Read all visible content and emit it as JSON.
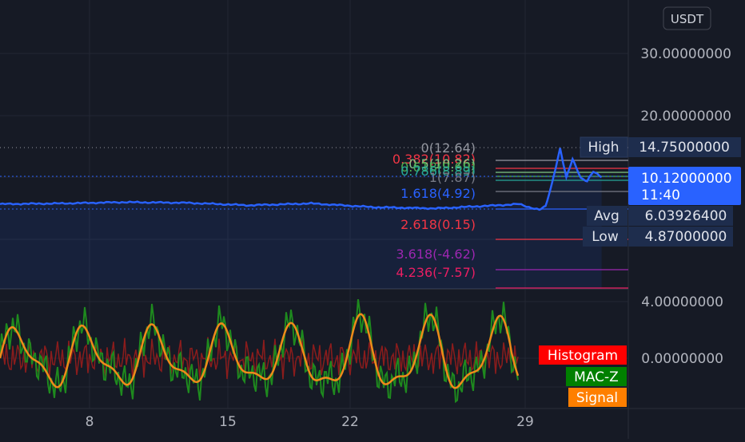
{
  "currency_button": "USDT",
  "chart_data": [
    {
      "type": "line",
      "panel": "price",
      "y_ticks": [
        "30.00000000",
        "20.00000000"
      ],
      "ylim": [
        -12,
        34
      ],
      "x": [
        0,
        3,
        6,
        9,
        12,
        15,
        18,
        21,
        24,
        25,
        25.5,
        26,
        26.3,
        26.6,
        27,
        27.3,
        27.6,
        28,
        28.3,
        28.6,
        29
      ],
      "series": [
        {
          "values": [
            5.8,
            5.9,
            6.1,
            6.0,
            5.6,
            5.9,
            5.3,
            5.1,
            5.6,
            5.8,
            5.3,
            4.9,
            5.4,
            9.0,
            14.75,
            10.0,
            13.0,
            10.0,
            9.5,
            11.0,
            10.12
          ]
        }
      ],
      "last_price": "10.12000000",
      "countdown": "11:40",
      "high_label": "High",
      "high_value": "14.75000000",
      "avg_label": "Avg",
      "avg_value": "6.03926400",
      "low_label": "Low",
      "low_value": "4.87000000",
      "fib_levels": [
        {
          "label": "0(12.64)",
          "color": "#9598a1"
        },
        {
          "label": "0.382(10.82)",
          "color": "#f23645"
        },
        {
          "label": "0.5(10.26)",
          "color": "#81c784"
        },
        {
          "label": "0.618(9.69)",
          "color": "#4caf50"
        },
        {
          "label": "0.786(8.89)",
          "color": "#26a69a"
        },
        {
          "label": "1(7.87)",
          "color": "#787b86"
        },
        {
          "label": "1.618(4.92)",
          "color": "#2962ff"
        },
        {
          "label": "2.618(0.15)",
          "color": "#f23645"
        },
        {
          "label": "3.618(-4.62)",
          "color": "#9c27b0"
        },
        {
          "label": "4.236(-7.57)",
          "color": "#e91e63"
        }
      ]
    },
    {
      "type": "line",
      "panel": "oscillator",
      "y_ticks": [
        "4.00000000",
        "0.00000000"
      ],
      "ylim": [
        -4.5,
        5
      ],
      "legend": [
        {
          "name": "Histogram",
          "color": "#ff0000"
        },
        {
          "name": "MAC-Z",
          "color": "#008000"
        },
        {
          "name": "Signal",
          "color": "#ff7f00"
        }
      ]
    }
  ],
  "x_axis_labels": [
    "8",
    "15",
    "22",
    "29"
  ]
}
